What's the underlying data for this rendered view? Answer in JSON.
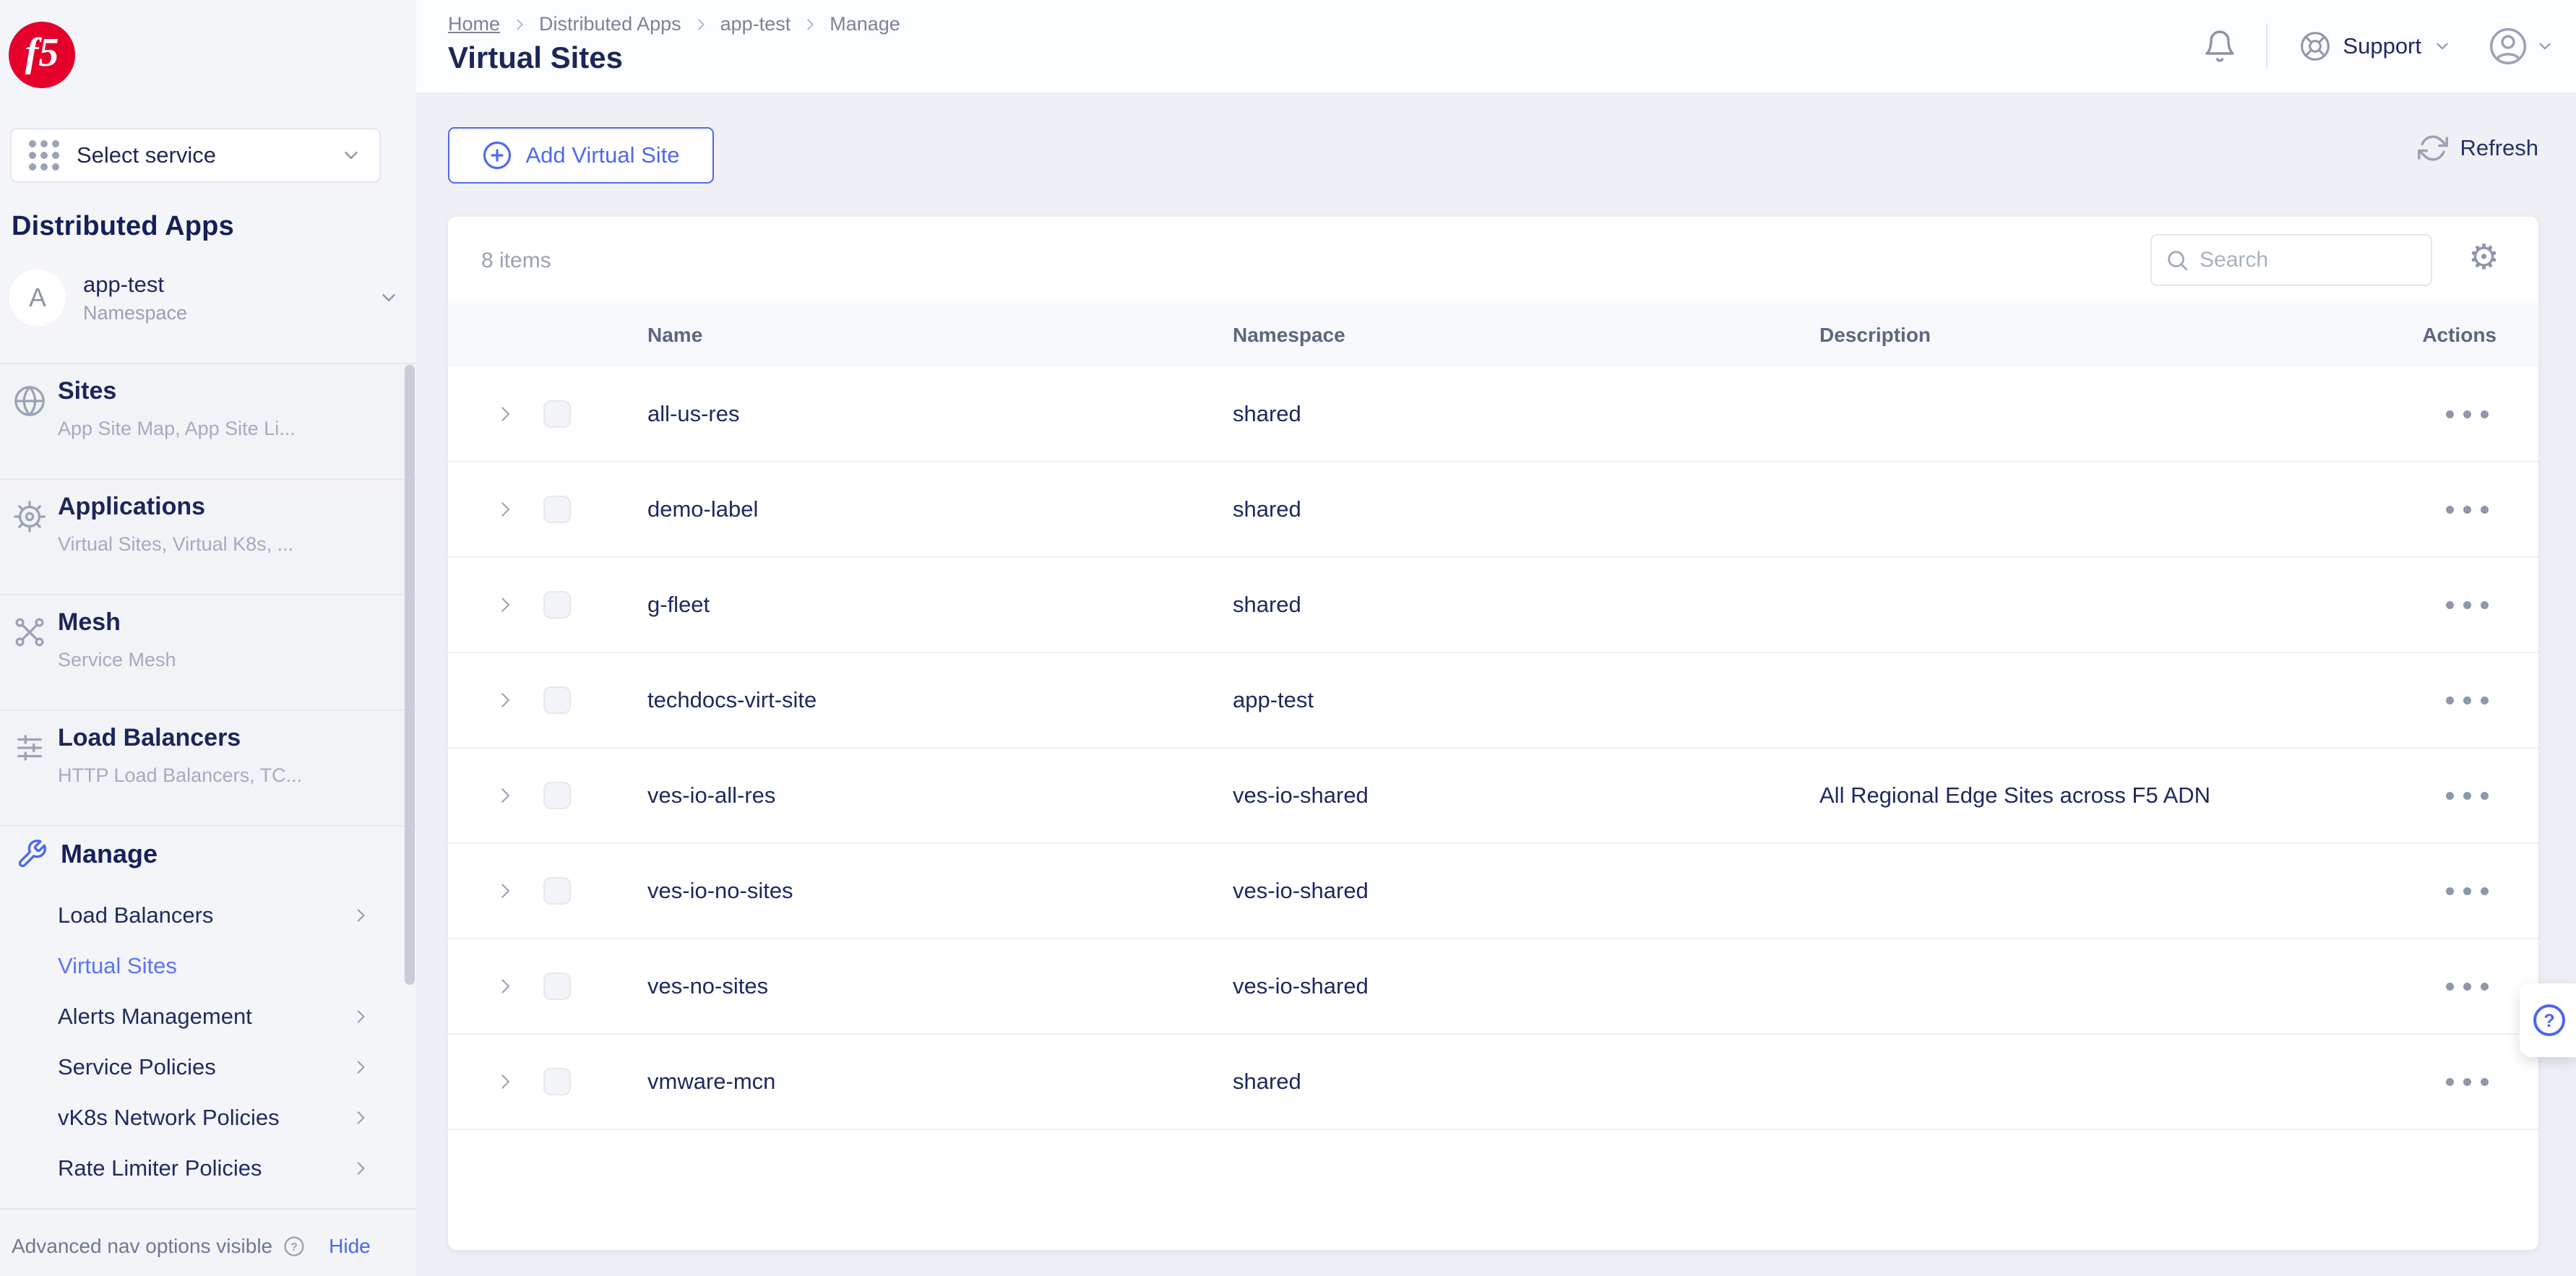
{
  "brand": {
    "logo_text": "f5",
    "logo_color": "#e4002b"
  },
  "colors": {
    "accent_blue": "#4c66f0",
    "navy_text": "#1e2659",
    "brand_red": "#e4002b",
    "gray_icon": "#9aa2b6"
  },
  "sidebar": {
    "select_service": {
      "label": "Select service"
    },
    "section_title": "Distributed Apps",
    "namespace": {
      "initial": "A",
      "name": "app-test",
      "type_label": "Namespace"
    },
    "sections": [
      {
        "title": "Sites",
        "subtitle": "App Site Map, App Site Li...",
        "icon": "globe-icon"
      },
      {
        "title": "Applications",
        "subtitle": "Virtual Sites, Virtual K8s, ...",
        "icon": "helm-wheel-icon"
      },
      {
        "title": "Mesh",
        "subtitle": "Service Mesh",
        "icon": "mesh-nodes-icon"
      },
      {
        "title": "Load Balancers",
        "subtitle": "HTTP Load Balancers, TC...",
        "icon": "load-balancer-icon"
      }
    ],
    "manage": {
      "title": "Manage"
    },
    "manage_items": [
      {
        "label": "Load Balancers",
        "chevron": true,
        "active": false
      },
      {
        "label": "Virtual Sites",
        "chevron": false,
        "active": true
      },
      {
        "label": "Alerts Management",
        "chevron": true,
        "active": false
      },
      {
        "label": "Service Policies",
        "chevron": true,
        "active": false
      },
      {
        "label": "vK8s Network Policies",
        "chevron": true,
        "active": false
      },
      {
        "label": "Rate Limiter Policies",
        "chevron": true,
        "active": false
      }
    ],
    "footer": {
      "label": "Advanced nav options visible",
      "action": "Hide"
    }
  },
  "header": {
    "breadcrumb": [
      "Home",
      "Distributed Apps",
      "app-test",
      "Manage"
    ],
    "title": "Virtual Sites",
    "support_label": "Support"
  },
  "toolbar": {
    "add_button": "Add Virtual Site",
    "refresh_label": "Refresh"
  },
  "table": {
    "items_count": "8 items",
    "search_placeholder": "Search",
    "columns": [
      "Name",
      "Namespace",
      "Description",
      "Actions"
    ],
    "rows": [
      {
        "name": "all-us-res",
        "namespace": "shared",
        "description": ""
      },
      {
        "name": "demo-label",
        "namespace": "shared",
        "description": ""
      },
      {
        "name": "g-fleet",
        "namespace": "shared",
        "description": ""
      },
      {
        "name": "techdocs-virt-site",
        "namespace": "app-test",
        "description": ""
      },
      {
        "name": "ves-io-all-res",
        "namespace": "ves-io-shared",
        "description": "All Regional Edge Sites across F5 ADN"
      },
      {
        "name": "ves-io-no-sites",
        "namespace": "ves-io-shared",
        "description": ""
      },
      {
        "name": "ves-no-sites",
        "namespace": "ves-io-shared",
        "description": ""
      },
      {
        "name": "vmware-mcn",
        "namespace": "shared",
        "description": ""
      }
    ]
  }
}
